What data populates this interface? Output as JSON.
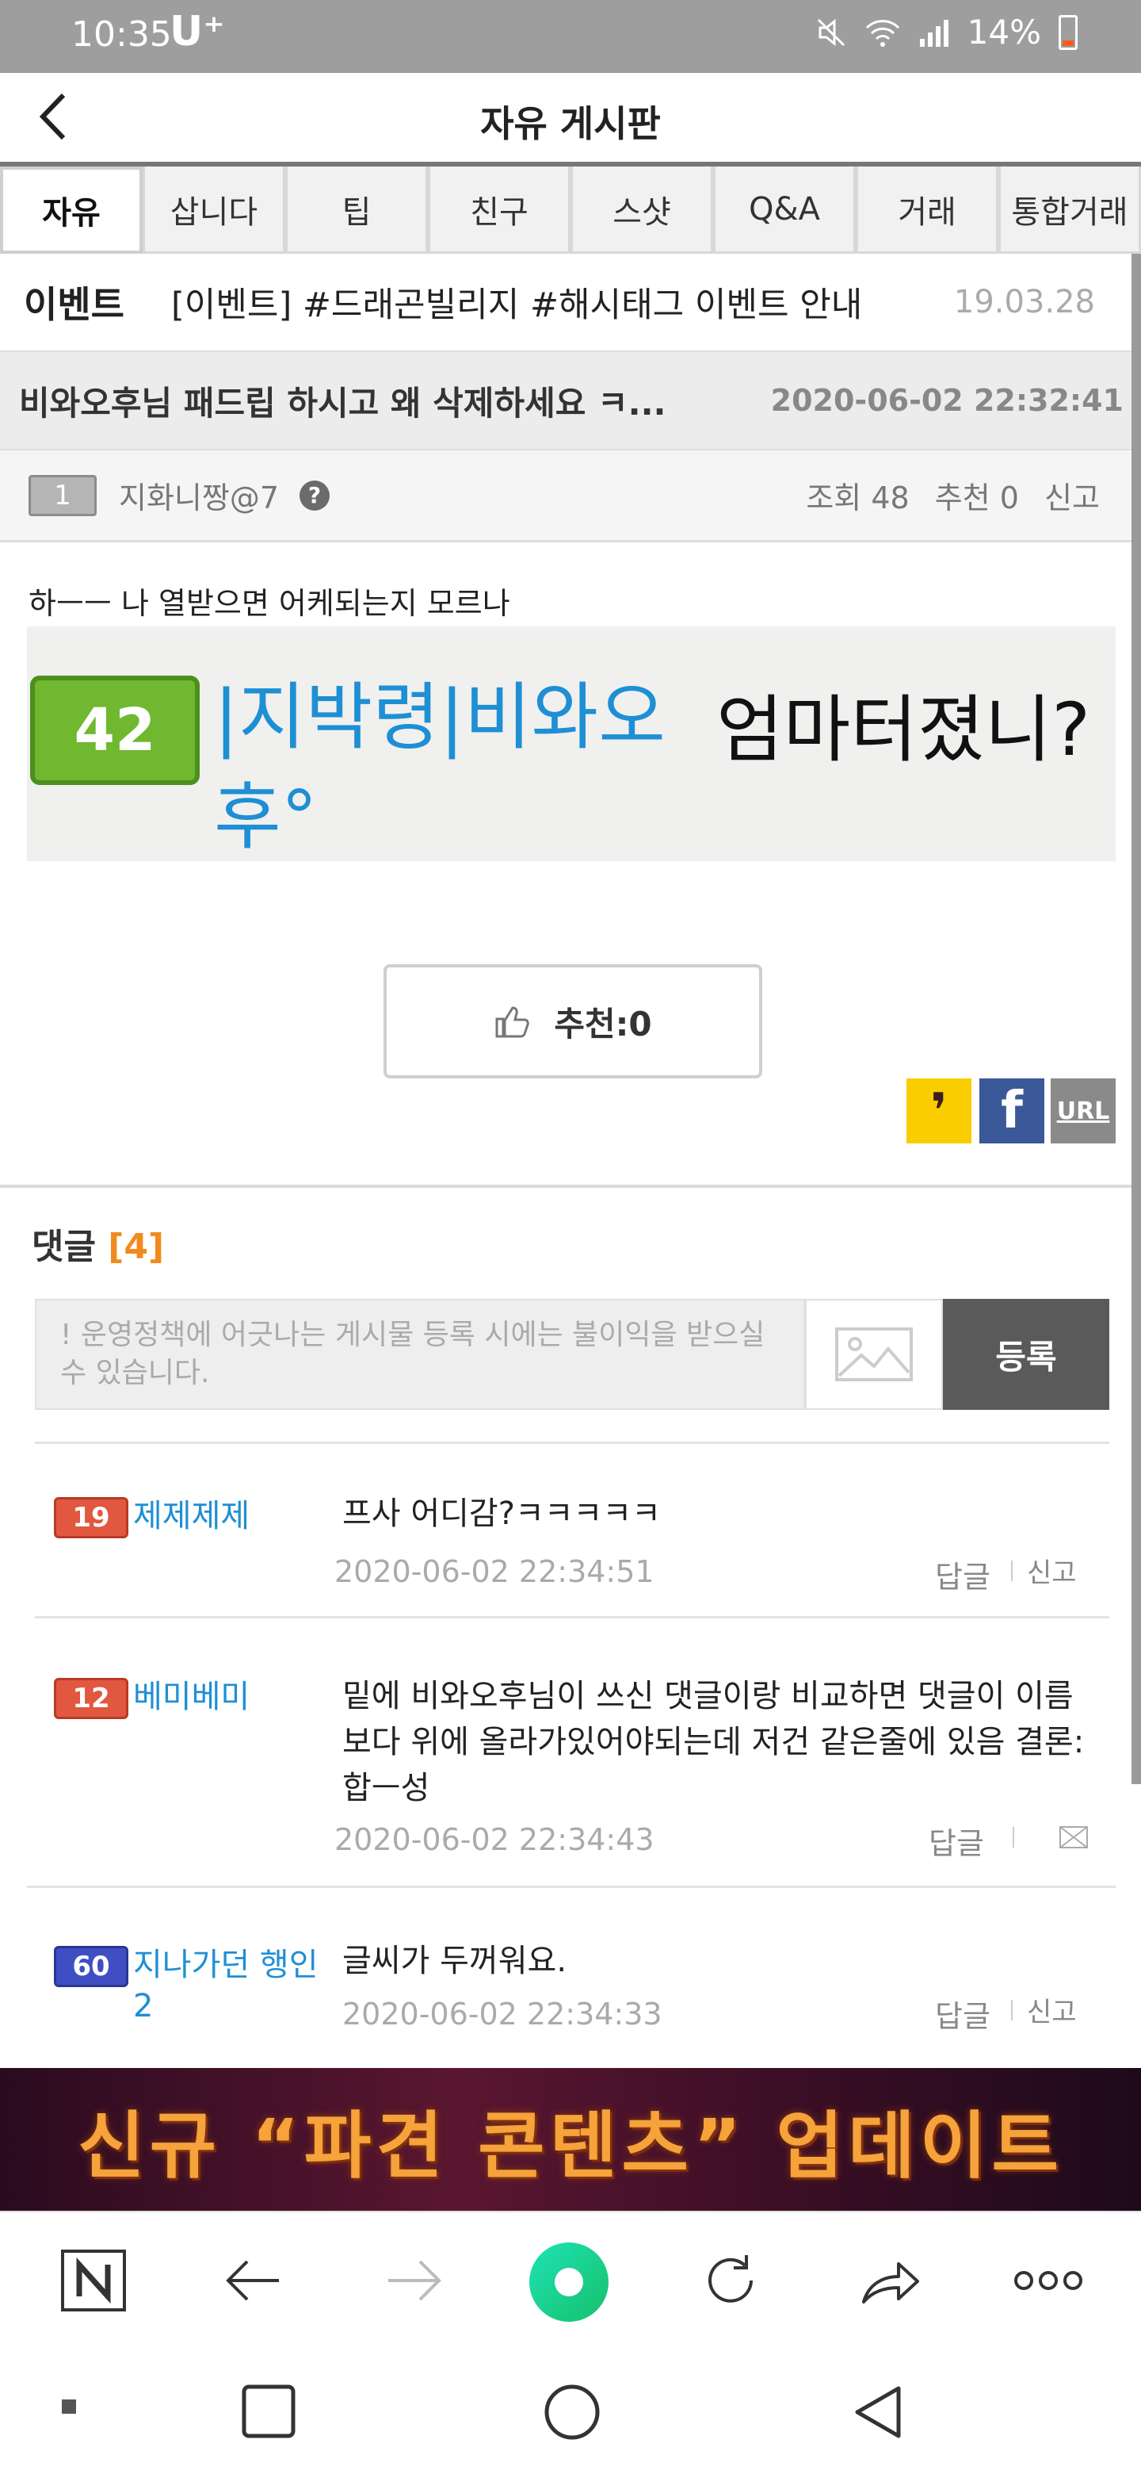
{
  "status_bar": {
    "time": "10:35",
    "carrier": "U⁺",
    "battery": "14%"
  },
  "header": {
    "title": "자유 게시판"
  },
  "tabs": [
    "자유",
    "삽니다",
    "팁",
    "친구",
    "스샷",
    "Q&A",
    "거래",
    "통합거래"
  ],
  "active_tab": 0,
  "event": {
    "label": "이벤트",
    "text": "[이벤트] #드래곤빌리지 #해시태그 이벤트 안내",
    "date": "19.03.28"
  },
  "post": {
    "title": "비와오후님 패드립 하시고 왜 삭제하세요 ㅋ...",
    "datetime": "2020-06-02 22:32:41",
    "author_level": "1",
    "author": "지화니짱@7",
    "help_icon": "?",
    "views": "조회 48",
    "recommends": "추천 0",
    "report": "신고",
    "body_text": "하ㅡㅡ 나 열받으면 어케되는지 모르나",
    "banner": {
      "level": "42",
      "nickname": "|지박령|비와오후°",
      "phrase": "엄마터졌니?"
    },
    "like_label": "추천:0"
  },
  "share": {
    "kakao": "❜",
    "facebook": "f",
    "url": "URL"
  },
  "comments_header": {
    "label": "댓글",
    "count": "[4]"
  },
  "comment_input": {
    "placeholder": "! 운영정책에 어긋나는 게시물 등록 시에는 불이익을 받으실 수 있습니다.",
    "submit": "등록"
  },
  "comments": [
    {
      "level": "19",
      "name": "제제제제",
      "text": "프사 어디감?ㅋㅋㅋㅋㅋ",
      "date": "2020-06-02 22:34:51",
      "reply": "답글",
      "report": "신고"
    },
    {
      "level": "12",
      "name": "베미베미",
      "text": "밑에 비와오후님이 쓰신 댓글이랑 비교하면 댓글이 이름보다 위에 올라가있어야되는데 저건 같은줄에 있음 결론: 합ㅡ성",
      "date": "2020-06-02 22:34:43",
      "reply": "답글",
      "report": ""
    },
    {
      "level": "60",
      "name": "지나가던 행인2",
      "text": "글씨가 두꺼워요.",
      "date": "2020-06-02 22:34:33",
      "reply": "답글",
      "report": "신고"
    }
  ],
  "ad": {
    "text": "신규 “파견 콘텐츠” 업데이트"
  },
  "browser_bar": [
    "n-home-icon",
    "back-arrow-icon",
    "forward-arrow-icon",
    "whale-icon",
    "refresh-icon",
    "share-icon",
    "more-icon"
  ],
  "colors": {
    "accent_blue": "#1e8fd4",
    "count_orange": "#f28a1b",
    "submit_gray": "#5a5a5a"
  }
}
